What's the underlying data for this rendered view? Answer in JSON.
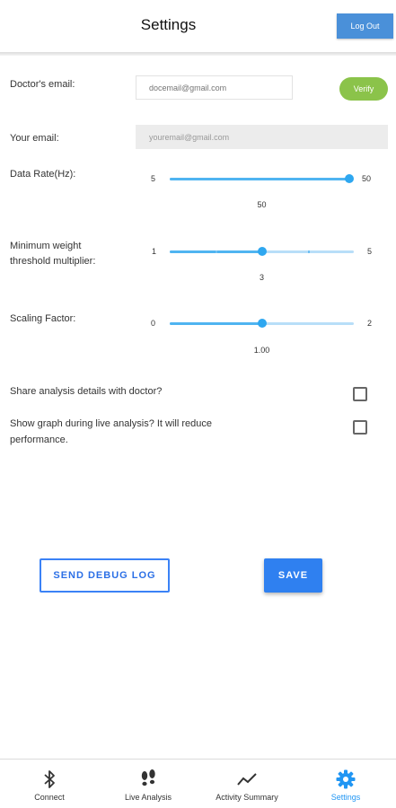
{
  "header": {
    "title": "Settings",
    "logout_label": "Log Out"
  },
  "doctor_email": {
    "label": "Doctor's email:",
    "placeholder": "docemail@gmail.com",
    "verify_label": "Verify"
  },
  "your_email": {
    "label": "Your email:",
    "value": "youremail@gmail.com"
  },
  "sliders": {
    "data_rate": {
      "label": "Data Rate(Hz):",
      "min": "5",
      "max": "50",
      "value": "50",
      "fraction": 1.0
    },
    "min_weight": {
      "label_line1": "Minimum weight",
      "label_line2": "threshold multiplier:",
      "min": "1",
      "max": "5",
      "value": "3",
      "fraction": 0.5
    },
    "scaling": {
      "label": "Scaling Factor:",
      "min": "0",
      "max": "2",
      "value": "1.00",
      "fraction": 0.5
    }
  },
  "options": {
    "share": {
      "label": "Share analysis details with doctor?",
      "checked": false
    },
    "graph": {
      "label_line1": "Show graph during live analysis? It will reduce",
      "label_line2": "performance.",
      "checked": false
    }
  },
  "actions": {
    "debug_label": "SEND DEBUG LOG",
    "save_label": "SAVE"
  },
  "nav": {
    "items": [
      {
        "label": "Connect",
        "icon": "bluetooth-icon"
      },
      {
        "label": "Live Analysis",
        "icon": "footprints-icon"
      },
      {
        "label": "Activity Summary",
        "icon": "trend-line-icon"
      },
      {
        "label": "Settings",
        "icon": "gear-icon"
      }
    ],
    "active_color": "#2196f3"
  },
  "colors": {
    "accent": "#2f80f0",
    "verify": "#8bc34a",
    "slider": "#2ea7f0"
  }
}
